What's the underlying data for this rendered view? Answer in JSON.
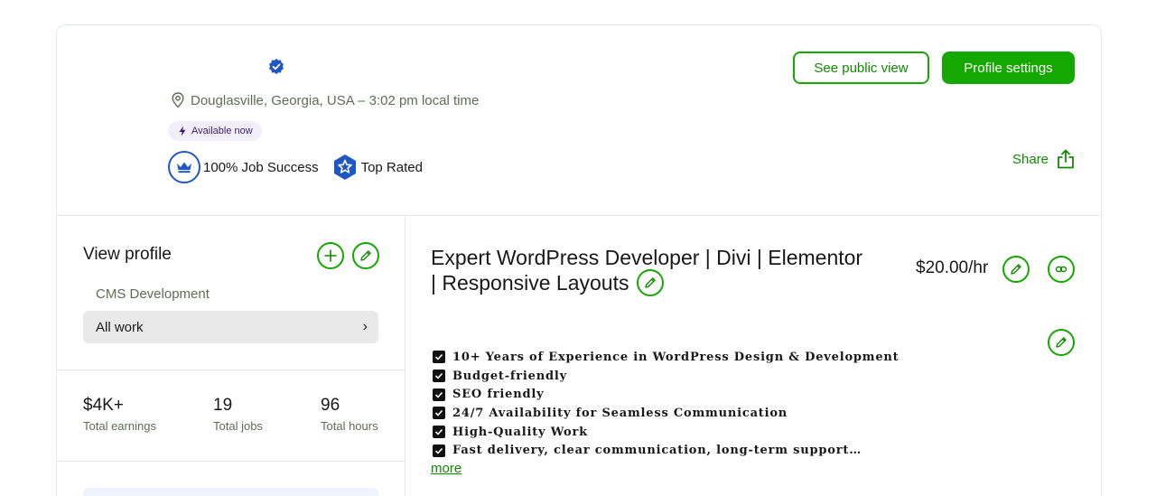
{
  "header": {
    "location": "Douglasville, Georgia, USA – 3:02 pm local time",
    "availability": "Available now",
    "job_success": "100% Job Success",
    "top_rated": "Top Rated",
    "see_public_view": "See public view",
    "profile_settings": "Profile settings",
    "share": "Share"
  },
  "sidebar": {
    "view_profile": "View profile",
    "category": "CMS Development",
    "all_work": "All work",
    "chevron": "›",
    "stats": [
      {
        "value": "$4K+",
        "label": "Total earnings"
      },
      {
        "value": "19",
        "label": "Total jobs"
      },
      {
        "value": "96",
        "label": "Total hours"
      }
    ]
  },
  "main": {
    "title": "Expert WordPress Developer | Divi | Elementor | Responsive Layouts",
    "rate": "$20.00/hr",
    "description": [
      "10+ Years of Experience in WordPress Design & Development",
      "Budget-friendly",
      "SEO friendly",
      "24/7 Availability for Seamless Communication",
      "High-Quality Work",
      "Fast delivery, clear communication, long-term support…"
    ],
    "more": "more"
  },
  "colors": {
    "brand_green": "#14a800",
    "link_green": "#108a00",
    "verified_blue": "#1f57c3",
    "muted_text": "#5e6d55"
  }
}
